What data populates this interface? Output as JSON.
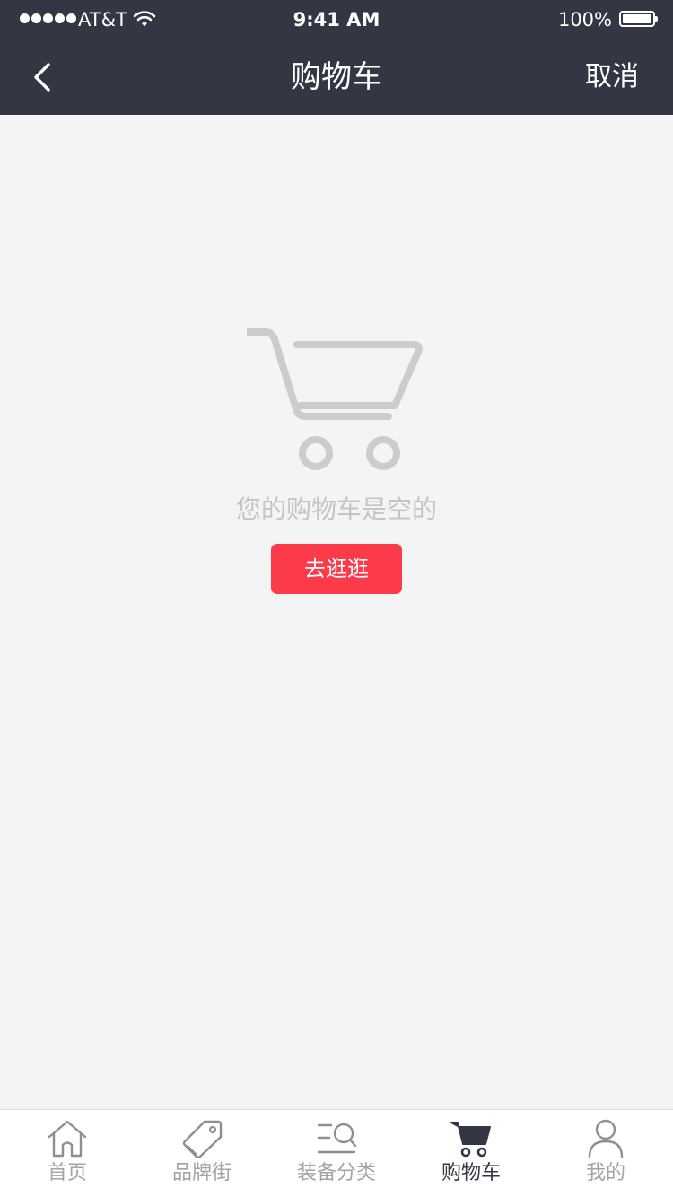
{
  "status_bar": {
    "carrier": "AT&T",
    "time": "9:41 AM",
    "battery": "100%"
  },
  "nav": {
    "title": "购物车",
    "cancel_label": "取消"
  },
  "empty_state": {
    "message": "您的购物车是空的",
    "button_label": "去逛逛"
  },
  "tabbar": {
    "items": [
      {
        "label": "首页",
        "icon": "home-icon"
      },
      {
        "label": "品牌街",
        "icon": "tag-icon"
      },
      {
        "label": "装备分类",
        "icon": "category-search-icon"
      },
      {
        "label": "购物车",
        "icon": "cart-icon",
        "active": true
      },
      {
        "label": "我的",
        "icon": "user-icon"
      }
    ]
  },
  "colors": {
    "header_bg": "#333743",
    "accent": "#fb3a4a",
    "page_bg": "#f4f4f4"
  }
}
